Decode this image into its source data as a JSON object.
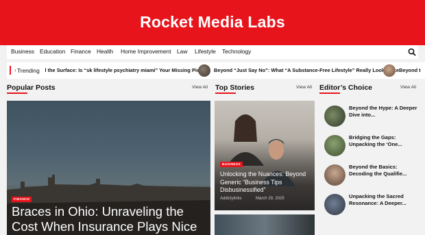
{
  "site": {
    "title": "Rocket Media Labs"
  },
  "nav": {
    "items": [
      "Business",
      "Education",
      "Finance",
      "Health",
      "Home Improvement",
      "Law",
      "Lifestyle",
      "Technology"
    ],
    "search_icon": "search-icon"
  },
  "trending": {
    "label": "Trending",
    "items": [
      "d the Surface: Is “sk lifestyle psychiatry miami” Your Missing Piece?",
      "Beyond “Just Say No”: What “A Substance-Free Lifestyle” Really Looks Like",
      "Beyond t"
    ]
  },
  "sections": {
    "popular": {
      "title": "Popular Posts",
      "view_all": "View All"
    },
    "top": {
      "title": "Top Stories",
      "view_all": "View All"
    },
    "editors": {
      "title": "Editor’s Choice",
      "view_all": "View All"
    }
  },
  "popular_main": {
    "tag": "FINANCE",
    "headline": "Braces in Ohio: Unraveling the Cost When Insurance Plays Nice"
  },
  "top_story": {
    "tag": "BUSINESS",
    "headline": "Unlocking the Nuances: Beyond Generic “Business Tips Disbusinessified”",
    "author": "Addictylinks",
    "date": "March 29, 2025"
  },
  "editors_choice": [
    {
      "title": "Beyond the Hype: A Deeper Dive into..."
    },
    {
      "title": "Bridging the Gaps: Unpacking the ‘One..."
    },
    {
      "title": "Beyond the Basics: Decoding the Qualifie..."
    },
    {
      "title": "Unpacking the Sacred Resonance: A Deeper..."
    }
  ],
  "colors": {
    "brand": "#e8141c",
    "background": "#f2f2f2"
  }
}
